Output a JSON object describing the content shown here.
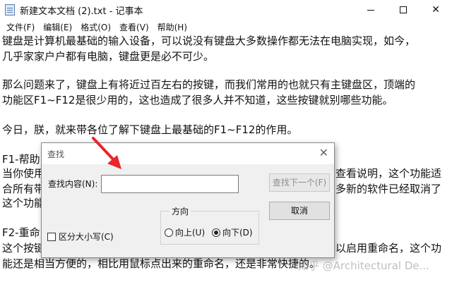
{
  "window": {
    "title": "新建文本文档 (2).txt - 记事本",
    "controls": {
      "minimize": "—",
      "maximize": "□",
      "close": "✕"
    }
  },
  "menubar": {
    "items": [
      "文件(F)",
      "编辑(E)",
      "格式(O)",
      "查看(V)",
      "帮助(H)"
    ]
  },
  "editor": {
    "lines": [
      "键盘是计算机最基础的输入设备，可以说没有键盘大多数操作都无法在电脑实现，如今，",
      "几乎家家户户都有电脑，键盘更是必不可少。",
      "",
      "那么问题来了，键盘上有将近过百左右的按键，而我们常用的也就只有主键盘区，顶端的",
      "功能区F1~F12是很少用的，这也造成了很多人并不知道，这些按键就别哪些功能。",
      "",
      "今日，朕，就来带各位了解下键盘上最基础的F1~F12的作用。",
      "",
      "F1-帮助",
      "当你使用",
      "合所有带",
      "这个功能",
      "",
      "F2-重命",
      "这个按键",
      "能还是相当方便的，相比用鼠标点出来的重命名，还是非常快捷的。"
    ],
    "right_fragments": [
      "查看说明，这个功能适",
      "多新的软件已经取消了",
      "以启用重命名，这个功"
    ]
  },
  "find_dialog": {
    "title": "查找",
    "close": "✕",
    "find_label": "查找内容(N):",
    "find_value": "",
    "find_next_button": "查找下一个(F)",
    "cancel_button": "取消",
    "direction_label": "方向",
    "direction_up": "向上(U)",
    "direction_down": "向下(D)",
    "direction_selected": "down",
    "match_case_label": "区分大小写(C)",
    "match_case_checked": false
  },
  "watermark": "知乎 @Architectural De...",
  "colors": {
    "arrow": "#e8262b",
    "dialog_bg": "#f0f0f0",
    "disabled_text": "#8c8c8c"
  }
}
